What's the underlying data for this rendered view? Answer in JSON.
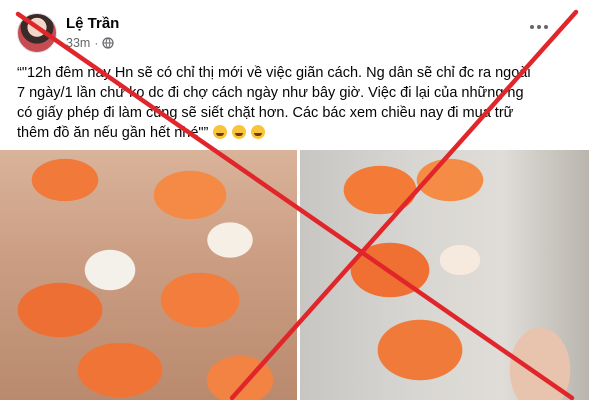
{
  "post": {
    "author": "Lệ Trần",
    "time": "33m",
    "separator": "·",
    "privacy_icon": "globe-icon",
    "more_icon": "more-options-icon",
    "text": "“\"12h đêm nay Hn sẽ có chỉ thị mới về việc giãn cách. Ng dân sẽ chỉ đc ra ngoài 7 ngày/1 lần chứ ko dc đi chợ cách ngày như bây giờ. Việc đi lại của những ng có giấy phép đi làm cũng sẽ siết chặt hơn. Các bác xem chiều nay đi mua trữ thêm đồ ăn nếu gần hết nhé\"”",
    "emojis": [
      "laughing-tears-emoji",
      "laughing-tears-emoji",
      "laughing-tears-emoji"
    ],
    "images": [
      "boiled-shrimp-photo-left",
      "boiled-shrimp-photo-right"
    ]
  },
  "overlay": {
    "mark": "red-x-cross",
    "color": "#e0262a"
  }
}
